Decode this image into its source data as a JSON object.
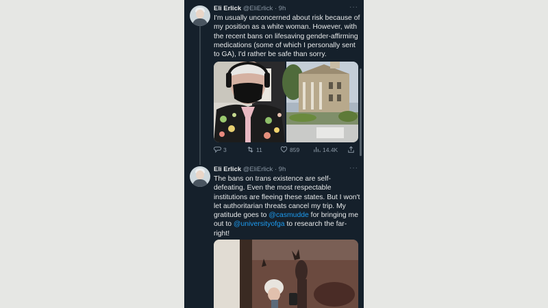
{
  "tweets": [
    {
      "name": "Eli Erlick",
      "handle": "@EliErlick",
      "time": "· 9h",
      "text": "I'm usually unconcerned about risk because of my position as a white woman. However, with the recent bans on lifesaving gender-affirming medications (some of which I personally sent to GA), I'd rather be safe than sorry.",
      "actions": {
        "replies": "3",
        "retweets": "11",
        "likes": "859",
        "views": "14.4K"
      }
    },
    {
      "name": "Eli Erlick",
      "handle": "@EliErlick",
      "time": "· 9h",
      "text_parts": {
        "p1": "The bans on trans existence are self-defeating. Even the most respectable institutions are fleeing these states. But I won't let authoritarian threats cancel my trip. My gratitude goes to ",
        "m1": "@casmudde",
        "p2": " for bringing me out to ",
        "m2": "@universityofga",
        "p3": " to research the far-right!"
      }
    }
  ],
  "icons": {
    "more": "more-dots-icon",
    "reply": "reply-icon",
    "retweet": "retweet-icon",
    "like": "heart-icon",
    "views": "views-icon",
    "share": "share-icon"
  },
  "colors": {
    "background": "#15202b",
    "text": "#e7e9ea",
    "secondary": "#8b98a5",
    "link": "#1d9bf0"
  }
}
